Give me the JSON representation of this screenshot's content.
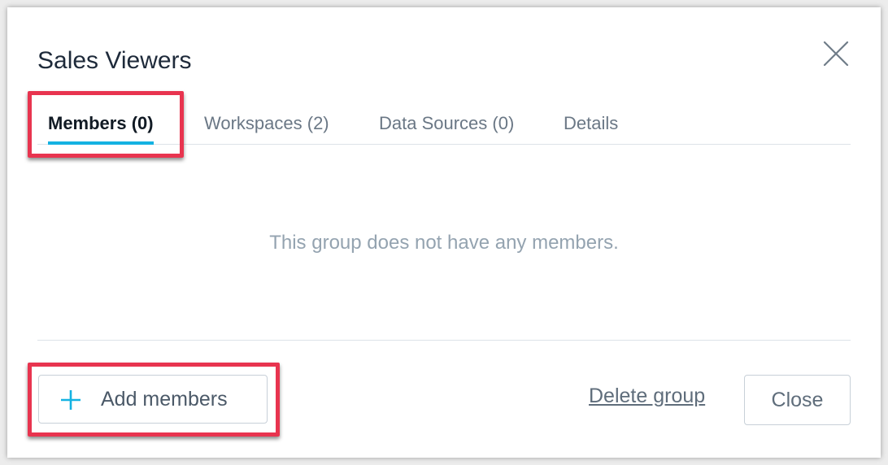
{
  "dialog": {
    "title": "Sales Viewers",
    "close_icon": "close-icon"
  },
  "tabs": [
    {
      "label": "Members (0)",
      "active": true
    },
    {
      "label": "Workspaces (2)",
      "active": false
    },
    {
      "label": "Data Sources (0)",
      "active": false
    },
    {
      "label": "Details",
      "active": false
    }
  ],
  "members": {
    "empty_message": "This group does not have any members."
  },
  "footer": {
    "add_members_label": "Add members",
    "add_icon": "plus-icon",
    "delete_label": "Delete group",
    "close_label": "Close"
  },
  "colors": {
    "accent": "#14b2e2",
    "highlight": "#e8344f",
    "title": "#1e2a3a",
    "muted_text": "#94a3b0"
  }
}
